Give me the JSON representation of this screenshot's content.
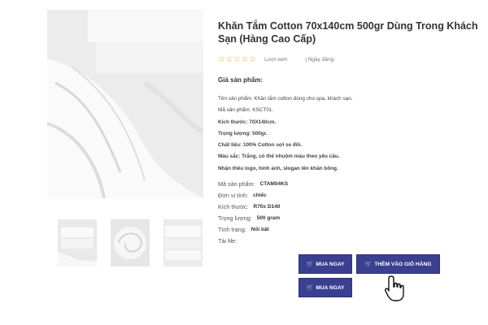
{
  "product": {
    "title": "Khăn Tắm Cotton 70x140cm 500gr Dùng Trong Khách Sạn (Hàng Cao Cấp)",
    "rating_stars": 5,
    "views_label": "Lượt xem",
    "date_label": "| Ngày đăng:",
    "price_label": "Giá sản phẩm:"
  },
  "description": [
    {
      "text": "Tên sản phẩm: Khăn tắm cotton dùng cho spa, khách sạn.",
      "bold": false
    },
    {
      "text": "Mã sản phẩm: KSCT01.",
      "bold": false
    },
    {
      "text": "Kích thước: 70X140cm.",
      "bold": true
    },
    {
      "text": "Trọng lượng: 500gr.",
      "bold": true
    },
    {
      "text": "Chất liệu: 100% Cotton sợi se đôi.",
      "bold": true
    },
    {
      "text": "Màu sắc: Trắng, có thể nhuộm màu theo yêu cầu.",
      "bold": true
    },
    {
      "text": "Nhận thêu logo, hình ảnh, slogan lên khăn bông.",
      "bold": true
    }
  ],
  "specs": [
    {
      "key": "Mã sản phẩm:",
      "value": "CTAM04KS"
    },
    {
      "key": "Đơn vị tính:",
      "value": "chiếc"
    },
    {
      "key": "Kích thước:",
      "value": "R70x D140"
    },
    {
      "key": "Trọng lượng:",
      "value": "500 gram"
    },
    {
      "key": "Tình trạng:",
      "value": "Nổi bật"
    },
    {
      "key": "Tải file:",
      "value": ""
    }
  ],
  "buttons": {
    "buy_now": "MUA NGAY",
    "add_to_cart": "THÊM VÀO GIỎ HÀNG",
    "buy_now_2": "MUA NGAY"
  },
  "colors": {
    "button_bg": "#3b3f8f",
    "star": "#f0a030"
  },
  "icons": {
    "cart": "cart-icon",
    "cursor": "hand-pointer-icon",
    "star": "star-outline-icon"
  }
}
